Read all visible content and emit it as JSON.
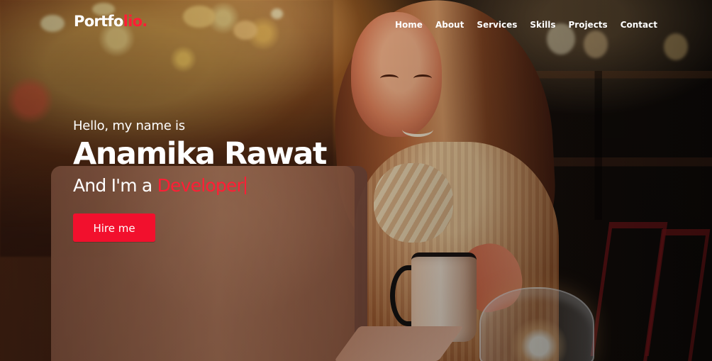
{
  "brand": {
    "logo_main": "Portfo",
    "logo_accent": "lio.",
    "accent_color": "#ff1e35"
  },
  "nav": {
    "items": [
      {
        "label": "Home"
      },
      {
        "label": "About"
      },
      {
        "label": "Services"
      },
      {
        "label": "Skills"
      },
      {
        "label": "Projects"
      },
      {
        "label": "Contact"
      }
    ]
  },
  "hero": {
    "intro": "Hello, my name is",
    "name": "Anamika Rawat",
    "role_prefix": "And I'm a",
    "role": "Developer",
    "cta_label": "Hire me",
    "background_icon": "cafe-photo-woman-laptop-icon"
  },
  "colors": {
    "text": "#ffffff",
    "button": "#f2102d",
    "role": "#ff1e35"
  }
}
